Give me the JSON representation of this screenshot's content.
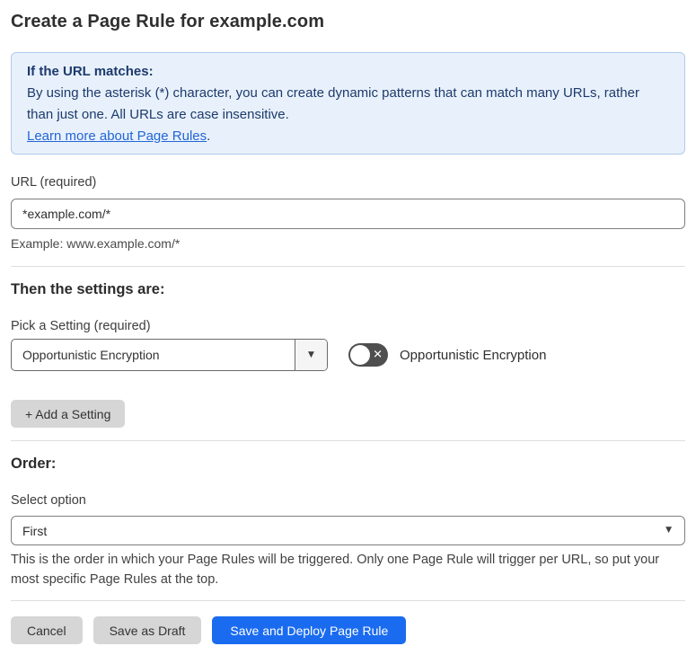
{
  "page": {
    "title": "Create a Page Rule for example.com"
  },
  "info_box": {
    "heading": "If the URL matches:",
    "body": "By using the asterisk (*) character, you can create dynamic patterns that can match many URLs, rather than just one. All URLs are case insensitive.",
    "link_label": "Learn more about Page Rules",
    "link_suffix": "."
  },
  "url_field": {
    "label": "URL (required)",
    "value": "*example.com/*",
    "hint": "Example: www.example.com/*"
  },
  "settings_section": {
    "heading": "Then the settings are:",
    "picker_label": "Pick a Setting (required)",
    "selected_setting": "Opportunistic Encryption",
    "toggle": {
      "state": "off",
      "label": "Opportunistic Encryption"
    },
    "add_setting_label": "+ Add a Setting"
  },
  "order_section": {
    "heading": "Order:",
    "select_label": "Select option",
    "selected_option": "First",
    "description": "This is the order in which your Page Rules will be triggered. Only one Page Rule will trigger per URL, so put your most specific Page Rules at the top."
  },
  "actions": {
    "cancel_label": "Cancel",
    "save_draft_label": "Save as Draft",
    "save_deploy_label": "Save and Deploy Page Rule"
  },
  "icons": {
    "dropdown_arrow": "▼",
    "select_arrow": "▼",
    "toggle_x": "✕"
  },
  "colors": {
    "accent_blue": "#1A6BEF",
    "info_bg": "#E8F1FB",
    "info_border": "#AFCBE9",
    "info_text": "#1D3A6D",
    "link_blue": "#2365D6",
    "toggle_off": "#4F4F4F",
    "button_gray": "#D6D6D6"
  }
}
